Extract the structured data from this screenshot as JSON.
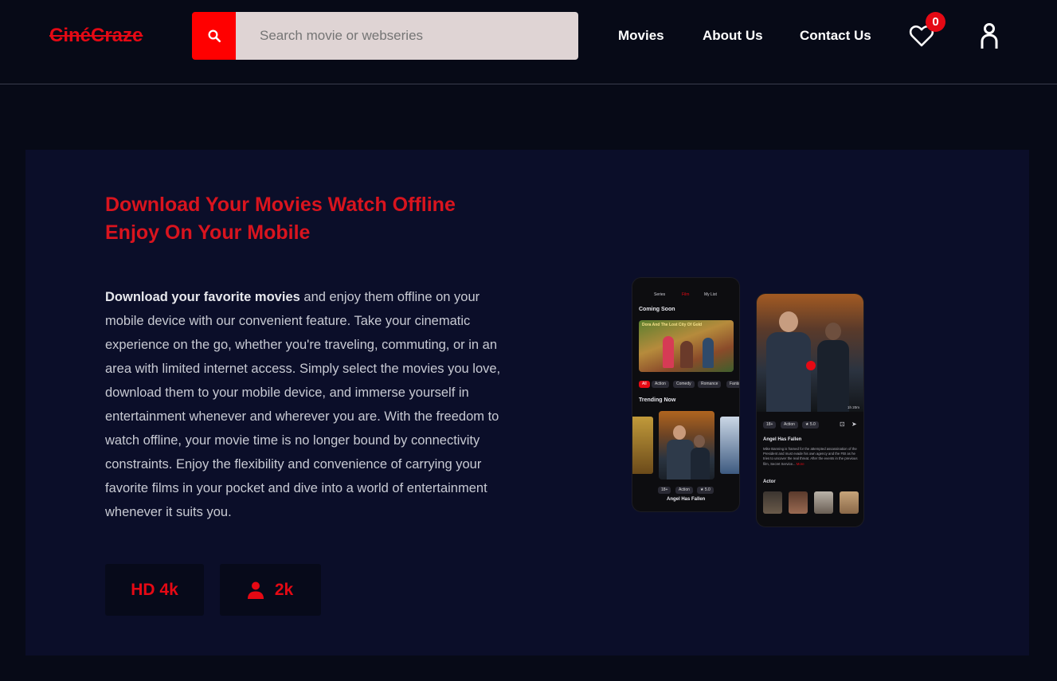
{
  "header": {
    "logo": "CinéCraze",
    "search": {
      "placeholder": "Search movie or webseries",
      "icon": "search-icon"
    },
    "nav": [
      {
        "label": "Movies"
      },
      {
        "label": "About Us"
      },
      {
        "label": "Contact Us"
      }
    ],
    "wishlist": {
      "icon": "heart-icon",
      "count": "0"
    },
    "account": {
      "icon": "user-icon"
    }
  },
  "hero": {
    "headline_line1": "Download Your Movies Watch Offline",
    "headline_line2": "Enjoy On Your Mobile",
    "description_bold": "Download your favorite movies",
    "description_rest": " and enjoy them offline on your mobile device with our convenient feature. Take your cinematic experience on the go, whether you're traveling, commuting, or in an area with limited internet access. Simply select the movies you love, download them to your mobile device, and immerse yourself in entertainment whenever and wherever you are. With the freedom to watch offline, your movie time is no longer bound by connectivity constraints. Enjoy the flexibility and convenience of carrying your favorite films in your pocket and dive into a world of entertainment whenever it suits you.",
    "stats": [
      {
        "label": "HD 4k"
      },
      {
        "label": "2k",
        "icon": "user-icon"
      }
    ]
  },
  "phone_left": {
    "tabs": [
      "Series",
      "Film",
      "My List"
    ],
    "coming_soon": "Coming Soon",
    "featured_title": "Dora And The Lost City Of Gold",
    "genres": [
      "All",
      "Action",
      "Comedy",
      "Romance",
      "Fanta"
    ],
    "trending_now": "Trending Now",
    "rating_badge": "18+",
    "genre": "Action",
    "score": "5.0",
    "movie_title": "Angel Has Fallen"
  },
  "phone_right": {
    "duration": "1h 20m",
    "rating_badge": "18+",
    "genre": "Action",
    "score": "5.0",
    "movie_title": "Angel Has Fallen",
    "synopsis": "Mike Banning is framed for the attempted assassination of the President and must evade his own agency and the FBI as he tries to uncover the real threat. After the events in the previous film, Secret Service...",
    "more_label": "More",
    "actor_heading": "Actor"
  },
  "colors": {
    "accent": "#e50914",
    "background": "#070a17",
    "panel": "#0b0e29"
  }
}
